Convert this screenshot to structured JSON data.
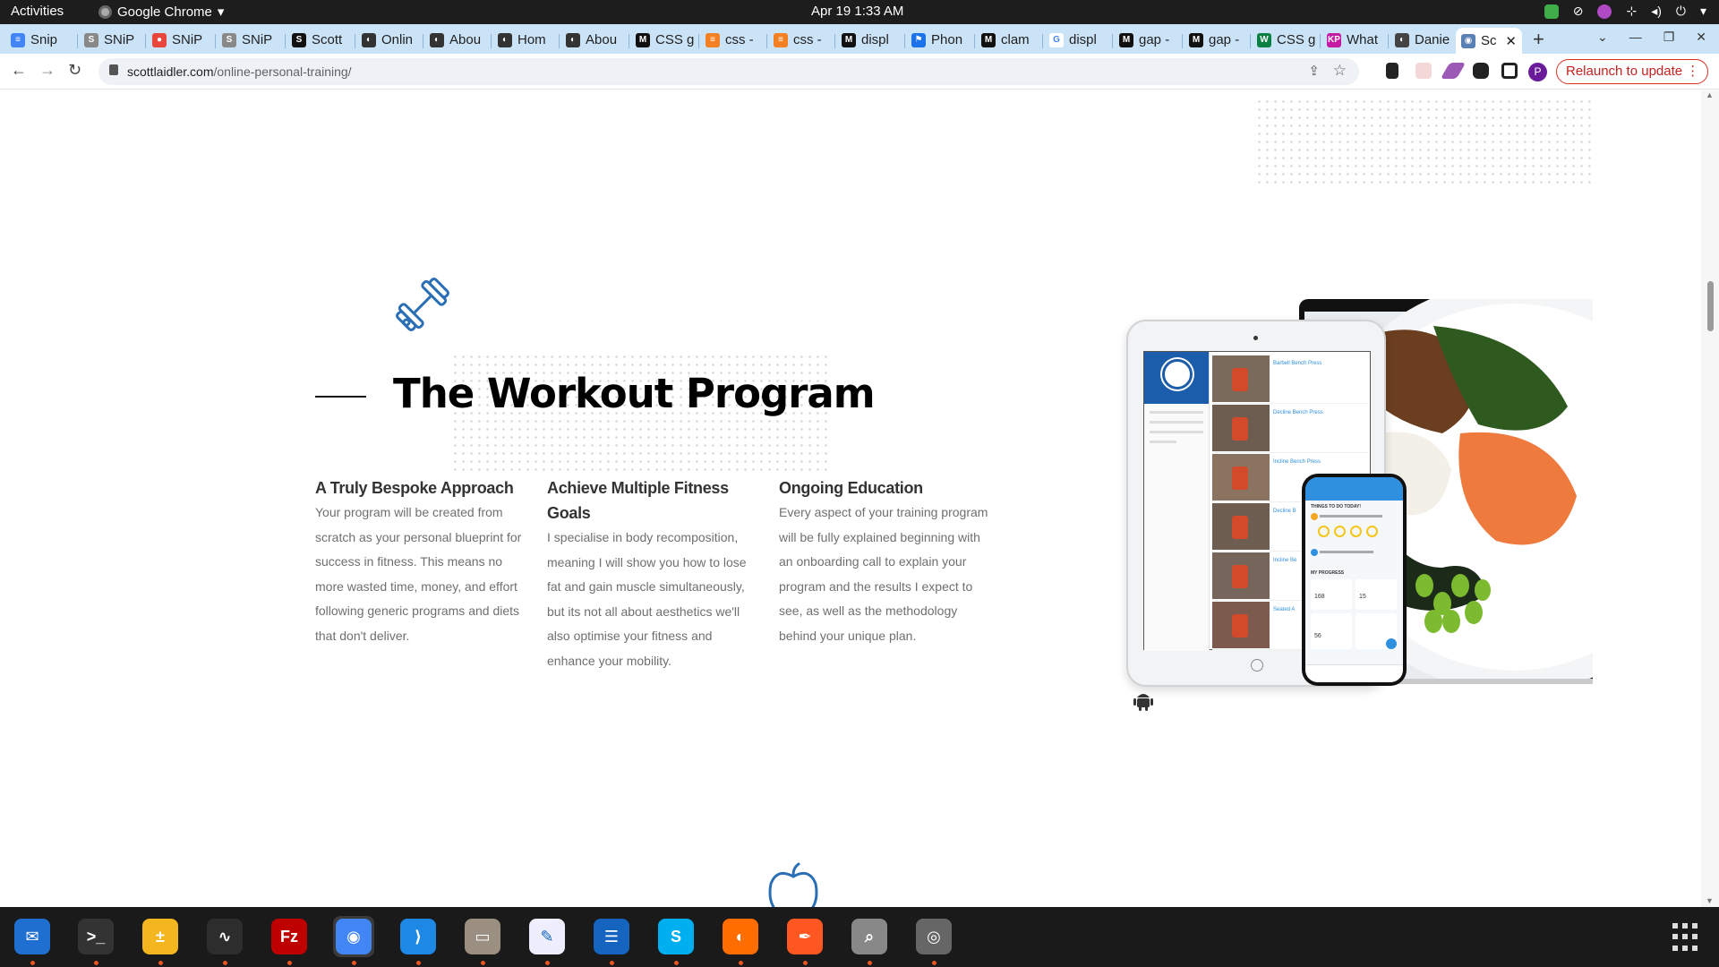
{
  "system": {
    "activities": "Activities",
    "app_name": "Google Chrome",
    "clock": "Apr 19  1:33 AM"
  },
  "tabs": [
    {
      "title": "Snip",
      "fav": "#4285f4",
      "glyph": "≡"
    },
    {
      "title": "SNiP",
      "fav": "#888",
      "glyph": "S"
    },
    {
      "title": "SNiP",
      "fav": "#e8453c",
      "glyph": "●"
    },
    {
      "title": "SNiP",
      "fav": "#888",
      "glyph": "S"
    },
    {
      "title": "Scott",
      "fav": "#111",
      "glyph": "S"
    },
    {
      "title": "Onlin",
      "fav": "#333",
      "glyph": "◐"
    },
    {
      "title": "Abou",
      "fav": "#333",
      "glyph": "◐"
    },
    {
      "title": "Hom",
      "fav": "#333",
      "glyph": "◐"
    },
    {
      "title": "Abou",
      "fav": "#333",
      "glyph": "◐"
    },
    {
      "title": "CSS g",
      "fav": "#111",
      "glyph": "M"
    },
    {
      "title": "css -",
      "fav": "#f48024",
      "glyph": "≡"
    },
    {
      "title": "css -",
      "fav": "#f48024",
      "glyph": "≡"
    },
    {
      "title": "displ",
      "fav": "#111",
      "glyph": "M"
    },
    {
      "title": "Phon",
      "fav": "#1a73e8",
      "glyph": "⚑"
    },
    {
      "title": "clam",
      "fav": "#111",
      "glyph": "M"
    },
    {
      "title": "displ",
      "fav": "#fff",
      "glyph": "G"
    },
    {
      "title": "gap -",
      "fav": "#111",
      "glyph": "M"
    },
    {
      "title": "gap -",
      "fav": "#111",
      "glyph": "M"
    },
    {
      "title": "CSS g",
      "fav": "#0b8043",
      "glyph": "W"
    },
    {
      "title": "What",
      "fav": "#c51aa3",
      "glyph": "KP"
    },
    {
      "title": "Danie",
      "fav": "#444",
      "glyph": "◐"
    },
    {
      "title": "Sc",
      "fav": "#5a7fb5",
      "glyph": "◉"
    }
  ],
  "toolbar": {
    "url_domain": "scottlaidler.com",
    "url_path": "/online-personal-training/",
    "relaunch_label": "Relaunch to update",
    "profile_initial": "P"
  },
  "section": {
    "title": "The Workout Program",
    "columns": [
      {
        "heading": "A Truly Bespoke Approach",
        "body": "Your program will be created from scratch as your personal blueprint for success in fitness. This means no more wasted time, money, and effort following generic programs and diets that don't deliver."
      },
      {
        "heading": "Achieve Multiple Fitness Goals",
        "body": "I specialise in body recomposition, meaning I will show you how to lose fat and gain muscle simultaneously, but its not all about aesthetics we'll also optimise your fitness and enhance your mobility."
      },
      {
        "heading": "Ongoing Education",
        "body": "Every aspect of your training program will be fully explained beginning with an onboarding call to explain your program and the results I expect to see, as well as the methodology behind your unique plan."
      }
    ]
  },
  "mockup": {
    "exercises": [
      "Barbell Bench Press",
      "Decline Bench Press",
      "Incline Bench Press",
      "Decline B",
      "Incline Be",
      "Seated A"
    ],
    "phone_heading": "THINGS TO DO TODAY!",
    "phone_progress": "MY PROGRESS",
    "phone_stat_1": "168",
    "phone_stat_2": "15",
    "phone_stat_3": "56"
  },
  "dock": [
    {
      "name": "thunderbird-icon",
      "color": "#1f6fd0",
      "glyph": "✉"
    },
    {
      "name": "terminal-icon",
      "color": "#333",
      "glyph": ">_"
    },
    {
      "name": "notes-icon",
      "color": "#f3b61f",
      "glyph": "±"
    },
    {
      "name": "system-monitor-icon",
      "color": "#2d2d2d",
      "glyph": "∿"
    },
    {
      "name": "filezilla-icon",
      "color": "#bf0000",
      "glyph": "Fz"
    },
    {
      "name": "chrome-icon",
      "color": "#4285f4",
      "glyph": "◉"
    },
    {
      "name": "vscode-icon",
      "color": "#1e88e5",
      "glyph": "⟩"
    },
    {
      "name": "files-icon",
      "color": "#9a8f80",
      "glyph": "▭"
    },
    {
      "name": "text-editor-icon",
      "color": "#eef",
      "glyph": "✎"
    },
    {
      "name": "writer-icon",
      "color": "#1565c0",
      "glyph": "☰"
    },
    {
      "name": "skype-icon",
      "color": "#00aff0",
      "glyph": "S"
    },
    {
      "name": "firefox-icon",
      "color": "#ff6d00",
      "glyph": "◐"
    },
    {
      "name": "inkscape-icon",
      "color": "#ff5722",
      "glyph": "✒"
    },
    {
      "name": "image-viewer-icon",
      "color": "#888",
      "glyph": "⌕"
    },
    {
      "name": "disk-icon",
      "color": "#666",
      "glyph": "◎"
    }
  ],
  "colors": {
    "accent": "#2a6fb5",
    "heading": "#000000",
    "body_text": "#6f6f6f",
    "relaunch": "#c5221f"
  }
}
